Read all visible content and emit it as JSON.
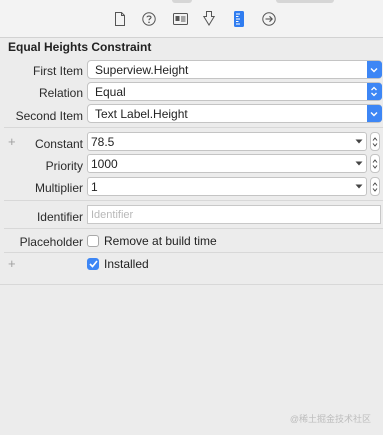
{
  "toolbar": {
    "tabs": [
      {
        "icon": "file-icon"
      },
      {
        "icon": "help-icon"
      },
      {
        "icon": "identity-icon"
      },
      {
        "icon": "attributes-icon"
      },
      {
        "icon": "size-ruler-icon",
        "selected": true
      },
      {
        "icon": "connections-icon"
      }
    ]
  },
  "panel": {
    "title": "Equal Heights Constraint"
  },
  "fields": {
    "first_item": {
      "label": "First Item",
      "value": "Superview.Height"
    },
    "relation": {
      "label": "Relation",
      "value": "Equal"
    },
    "second_item": {
      "label": "Second Item",
      "value": "Text Label.Height"
    },
    "constant": {
      "label": "Constant",
      "value": "78.5"
    },
    "priority": {
      "label": "Priority",
      "value": "1000"
    },
    "multiplier": {
      "label": "Multiplier",
      "value": "1"
    },
    "identifier": {
      "label": "Identifier",
      "value": "",
      "placeholder": "Identifier"
    },
    "placeholder": {
      "label": "Placeholder",
      "checkbox_label": "Remove at build time",
      "checked": false
    },
    "installed": {
      "checkbox_label": "Installed",
      "checked": true
    }
  },
  "plus_symbols": {
    "constant_plus": "+",
    "installed_plus": "+"
  },
  "watermark": "@稀土掘金技术社区",
  "colors": {
    "accent": "#3d86f5",
    "background": "#ececec"
  }
}
